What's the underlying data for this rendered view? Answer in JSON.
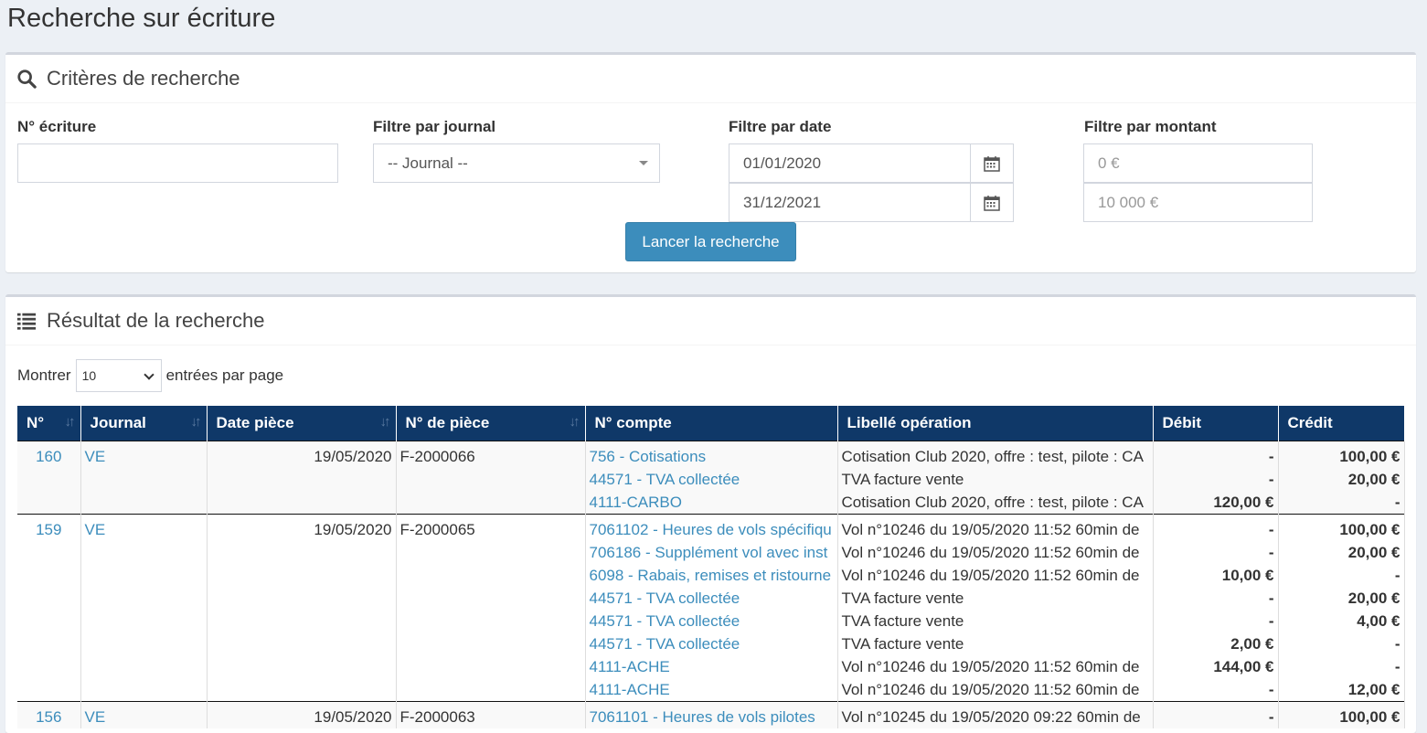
{
  "page": {
    "title": "Recherche sur écriture"
  },
  "criteria": {
    "header": "Critères de recherche",
    "entry_no_label": "N° écriture",
    "entry_no_value": "",
    "journal_label": "Filtre par journal",
    "journal_selected": "-- Journal --",
    "date_label": "Filtre par date",
    "date_from": "01/01/2020",
    "date_to": "31/12/2021",
    "amount_label": "Filtre par montant",
    "amount_min_placeholder": "0 €",
    "amount_max_placeholder": "10 000 €",
    "search_button": "Lancer la recherche"
  },
  "results": {
    "header": "Résultat de la recherche",
    "show_label": "Montrer",
    "page_size": "10",
    "per_page_label": "entrées par page",
    "columns": [
      "N°",
      "Journal",
      "Date pièce",
      "N° de pièce",
      "N° compte",
      "Libellé opération",
      "Débit",
      "Crédit"
    ],
    "rows": [
      {
        "no": "160",
        "journal": "VE",
        "date": "19/05/2020",
        "piece": "F-2000066",
        "accounts": [
          "756 - Cotisations",
          "44571 - TVA collectée",
          "4111-CARBO"
        ],
        "labels": [
          "Cotisation Club 2020, offre : test, pilote : CA",
          "TVA facture vente",
          "Cotisation Club 2020, offre : test, pilote : CA"
        ],
        "debits": [
          "-",
          "-",
          "120,00 €"
        ],
        "credits": [
          "100,00 €",
          "20,00 €",
          "-"
        ]
      },
      {
        "no": "159",
        "journal": "VE",
        "date": "19/05/2020",
        "piece": "F-2000065",
        "accounts": [
          "7061102 - Heures de vols spécifiqu",
          "706186 - Supplément vol avec inst",
          "6098 - Rabais, remises et ristourne",
          "44571 - TVA collectée",
          "44571 - TVA collectée",
          "44571 - TVA collectée",
          "4111-ACHE",
          "4111-ACHE"
        ],
        "labels": [
          "Vol n°10246 du 19/05/2020 11:52 60min de",
          "Vol n°10246 du 19/05/2020 11:52 60min de",
          "Vol n°10246 du 19/05/2020 11:52 60min de",
          "TVA facture vente",
          "TVA facture vente",
          "TVA facture vente",
          "Vol n°10246 du 19/05/2020 11:52 60min de",
          "Vol n°10246 du 19/05/2020 11:52 60min de"
        ],
        "debits": [
          "-",
          "-",
          "10,00 €",
          "-",
          "-",
          "2,00 €",
          "144,00 €",
          "-"
        ],
        "credits": [
          "100,00 €",
          "20,00 €",
          "-",
          "20,00 €",
          "4,00 €",
          "-",
          "-",
          "12,00 €"
        ]
      },
      {
        "no": "156",
        "journal": "VE",
        "date": "19/05/2020",
        "piece": "F-2000063",
        "accounts": [
          "7061101 - Heures de vols pilotes"
        ],
        "labels": [
          "Vol n°10245 du 19/05/2020 09:22 60min de"
        ],
        "debits": [
          "-"
        ],
        "credits": [
          "100,00 €"
        ]
      }
    ]
  },
  "colors": {
    "accent": "#3c8dbc",
    "table_header": "#0f3868",
    "background": "#ecf0f5"
  }
}
